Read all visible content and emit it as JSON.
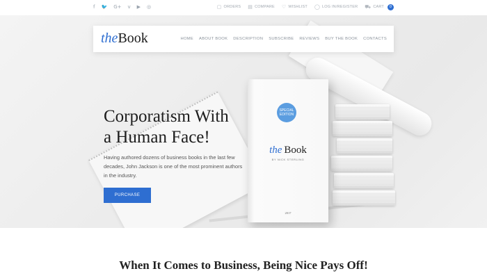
{
  "topbar": {
    "social": [
      "f",
      "🐦",
      "G+",
      "v",
      "▶",
      "◎"
    ],
    "utility": [
      {
        "icon": "receipt-icon",
        "glyph": "▢",
        "label": "ORDERS"
      },
      {
        "icon": "compare-icon",
        "glyph": "▤",
        "label": "COMPARE"
      },
      {
        "icon": "heart-icon",
        "glyph": "♡",
        "label": "WISHLIST"
      },
      {
        "icon": "user-icon",
        "glyph": "◯",
        "label": "LOG IN/REGISTER"
      },
      {
        "icon": "cart-icon",
        "glyph": "⛟",
        "label": "CART"
      }
    ],
    "cart_count": "0"
  },
  "header": {
    "logo_the": "the",
    "logo_book": "Book",
    "nav": [
      "HOME",
      "ABOUT BOOK",
      "DESCRIPTION",
      "SUBSCRIBE",
      "REVIEWS",
      "BUY THE BOOK",
      "CONTACTS"
    ]
  },
  "hero": {
    "headline_line1": "Corporatism With",
    "headline_line2": "a Human Face!",
    "intro": "Having authored dozens of business books in the last few decades, John Jackson is one of the most prominent authors in the industry.",
    "button": "PURCHASE"
  },
  "cover": {
    "badge_line1": "SPECIAL",
    "badge_line2": "EDITION",
    "title_the": "the",
    "title_book": "Book",
    "author": "BY NICK STERLING",
    "year": "2017"
  },
  "section": {
    "title": "When It Comes to Business, Being Nice Pays Off!"
  },
  "colors": {
    "accent": "#2e6ed1",
    "badge": "#5b9de0"
  }
}
